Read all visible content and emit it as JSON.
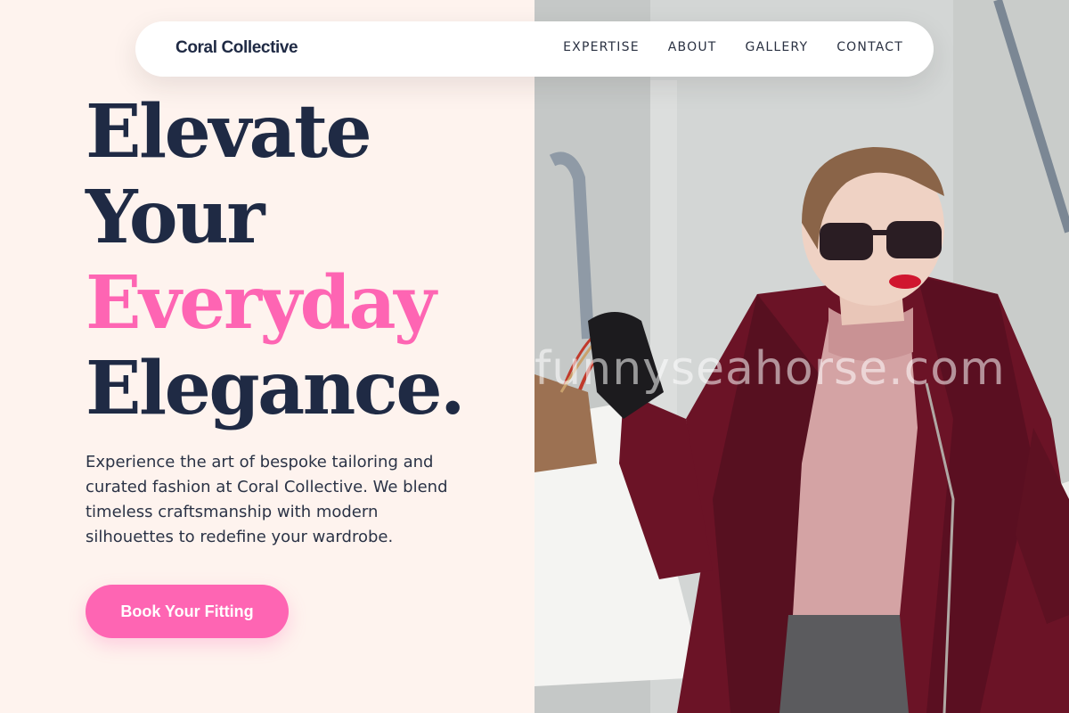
{
  "brand": {
    "name": "Coral Collective"
  },
  "nav": {
    "links": [
      "EXPERTISE",
      "ABOUT",
      "GALLERY",
      "CONTACT"
    ]
  },
  "hero": {
    "headline_lines": [
      "Elevate",
      "Your",
      "Everyday",
      "Elegance."
    ],
    "description": "Experience the art of bespoke tailoring and curated fashion at Coral Collective. We blend timeless craftsmanship with modern silhouettes to redefine your wardrobe.",
    "cta_label": "Book Your Fitting"
  },
  "photo": {
    "watermark": "funnyseahorse.com",
    "subject": "woman in burgundy coat and sunglasses holding shopping bags"
  },
  "colors": {
    "background": "#fef3ee",
    "navy": "#1f2a44",
    "accent_pink": "#fe65b3",
    "coat_burgundy": "#6b1326"
  }
}
